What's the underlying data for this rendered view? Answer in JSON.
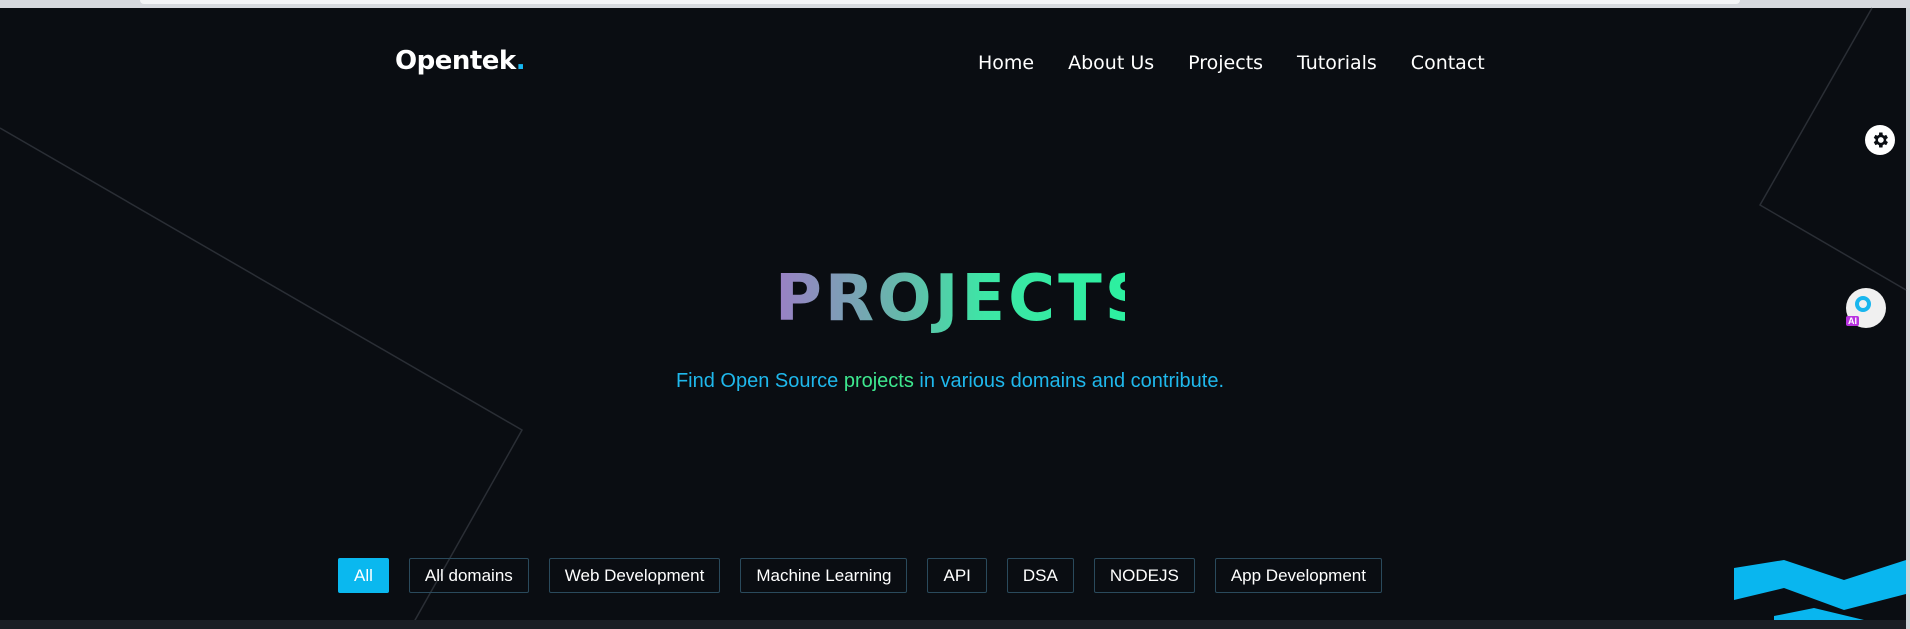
{
  "brand": {
    "name": "Opentek",
    "dot": ".",
    "accent_color": "#16b8f3"
  },
  "nav": {
    "items": [
      {
        "label": "Home"
      },
      {
        "label": "About Us"
      },
      {
        "label": "Projects"
      },
      {
        "label": "Tutorials"
      },
      {
        "label": "Contact"
      }
    ]
  },
  "hero": {
    "title": "PROJECTS",
    "subtitle_before": "Find Open Source",
    "subtitle_highlight": "projects",
    "subtitle_after": "in various domains and contribute."
  },
  "widgets": {
    "settings_icon": "gear-icon",
    "ai_assistant_icon": "ai-assistant-icon",
    "ai_badge": "AI"
  },
  "filters": {
    "active": "All",
    "items": [
      {
        "label": "All"
      },
      {
        "label": "All domains"
      },
      {
        "label": "Web Development"
      },
      {
        "label": "Machine Learning"
      },
      {
        "label": "API"
      },
      {
        "label": "DSA"
      },
      {
        "label": "NODEJS"
      },
      {
        "label": "App Development"
      }
    ]
  },
  "colors": {
    "background": "#0a0d12",
    "primary_blue": "#0ab8ef",
    "highlight_green": "#3ee88f"
  }
}
